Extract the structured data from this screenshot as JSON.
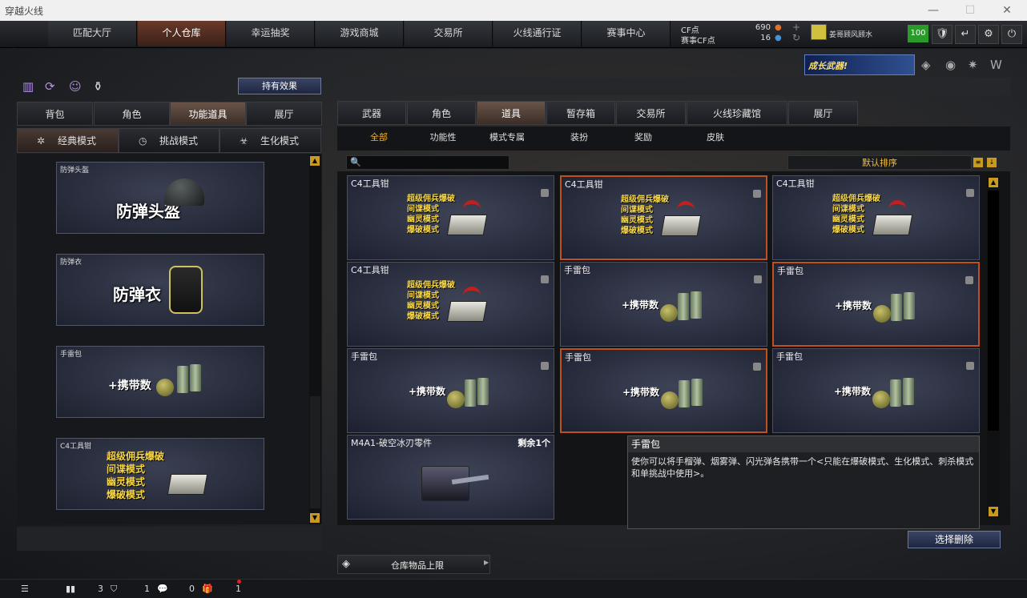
{
  "window": {
    "title": "穿越火线"
  },
  "nav": {
    "tabs": [
      "匹配大厅",
      "个人仓库",
      "幸运抽奖",
      "游戏商城",
      "交易所",
      "火线通行证",
      "赛事中心"
    ],
    "active": 1
  },
  "account": {
    "cf_label": "CF点",
    "cf_value": "690",
    "gift_cf_label": "赛事CF点",
    "gift_cf_value": "16",
    "rank_name": "姜哥顾风顾水",
    "level": "100"
  },
  "banner": {
    "text": "成长武器!"
  },
  "left": {
    "effects_button": "持有效果",
    "tabs": [
      "背包",
      "角色",
      "功能道具",
      "展厅"
    ],
    "active_tab": 2,
    "modes": [
      "经典模式",
      "挑战模式",
      "生化模式"
    ],
    "active_mode": 0,
    "items": [
      {
        "name": "防弹头盔",
        "big": "防弹头盔"
      },
      {
        "name": "防弹衣",
        "big": "防弹衣"
      },
      {
        "name": "手雷包",
        "big": "+携带数"
      },
      {
        "name": "C4工具钳",
        "modes": [
          "超级佣兵爆破",
          "间谍模式",
          "幽灵模式",
          "爆破模式"
        ]
      }
    ]
  },
  "right": {
    "tabs": [
      "武器",
      "角色",
      "道具",
      "暂存箱",
      "交易所",
      "火线珍藏馆",
      "展厅"
    ],
    "active_tab": 2,
    "subtabs": [
      "全部",
      "功能性",
      "模式专属",
      "装扮",
      "奖励",
      "皮肤"
    ],
    "active_subtab": 0,
    "search_placeholder": "",
    "sort_label": "默认排序",
    "grid": [
      {
        "name": "C4工具钳",
        "type": "c4",
        "modes": [
          "超级佣兵爆破",
          "间谍模式",
          "幽灵模式",
          "爆破模式"
        ],
        "selected": false
      },
      {
        "name": "C4工具钳",
        "type": "c4",
        "modes": [
          "超级佣兵爆破",
          "间谍模式",
          "幽灵模式",
          "爆破模式"
        ],
        "selected": true
      },
      {
        "name": "C4工具钳",
        "type": "c4",
        "modes": [
          "超级佣兵爆破",
          "间谍模式",
          "幽灵模式",
          "爆破模式"
        ],
        "selected": false
      },
      {
        "name": "C4工具钳",
        "type": "c4",
        "modes": [
          "超级佣兵爆破",
          "间谍模式",
          "幽灵模式",
          "爆破模式"
        ],
        "selected": false
      },
      {
        "name": "手雷包",
        "type": "grenade",
        "carry": "+携带数",
        "selected": false
      },
      {
        "name": "手雷包",
        "type": "grenade",
        "carry": "+携带数",
        "selected": true
      },
      {
        "name": "手雷包",
        "type": "grenade",
        "carry": "+携带数",
        "selected": false
      },
      {
        "name": "手雷包",
        "type": "grenade",
        "carry": "+携带数",
        "selected": true
      },
      {
        "name": "手雷包",
        "type": "grenade",
        "carry": "+携带数",
        "selected": false
      },
      {
        "name": "M4A1-破空冰刃零件",
        "type": "case",
        "remain": "剩余1个",
        "selected": false
      }
    ],
    "tooltip": {
      "title": "手雷包",
      "body": "使你可以将手榴弹、烟雾弹、闪光弹各携带一个<只能在爆破模式、生化模式、刺杀模式和单挑战中使用>。"
    },
    "delete_button": "选择删除",
    "capacity_label": "仓库物品上限"
  },
  "status": {
    "friends": "3",
    "shield": "1",
    "chat": "0",
    "gift": "1"
  }
}
